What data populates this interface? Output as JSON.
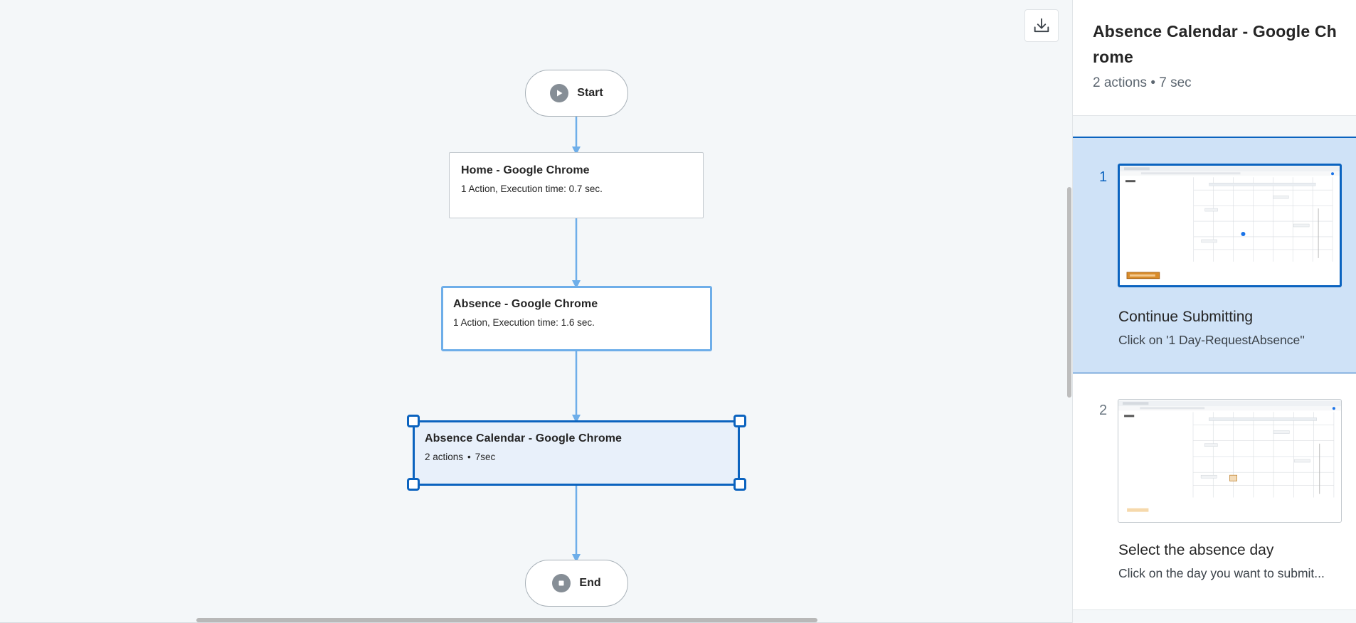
{
  "canvas": {
    "download_icon": "download-icon",
    "start_label": "Start",
    "end_label": "End",
    "steps": [
      {
        "title": "Home  - Google Chrome",
        "subtitle": "1 Action, Execution time: 0.7 sec."
      },
      {
        "title": "Absence - Google Chrome",
        "subtitle": "1 Action, Execution time: 1.6 sec."
      },
      {
        "title": "Absence Calendar - Google Chrome",
        "actions": "2 actions",
        "separator": "•",
        "time": "7sec"
      }
    ],
    "colors": {
      "connector": "#6eaee9",
      "selected": "#0b63bf",
      "selected_fill": "#e8f0fa"
    }
  },
  "panel": {
    "title": "Absence Calendar - Google Chrome",
    "summary": "2 actions • 7 sec",
    "actions": [
      {
        "number": "1",
        "title": "Continue Submitting",
        "description": "Click on '1 Day-RequestAbsence''"
      },
      {
        "number": "2",
        "title": "Select the absence day",
        "description": "Click on the day you want to submit..."
      }
    ]
  }
}
